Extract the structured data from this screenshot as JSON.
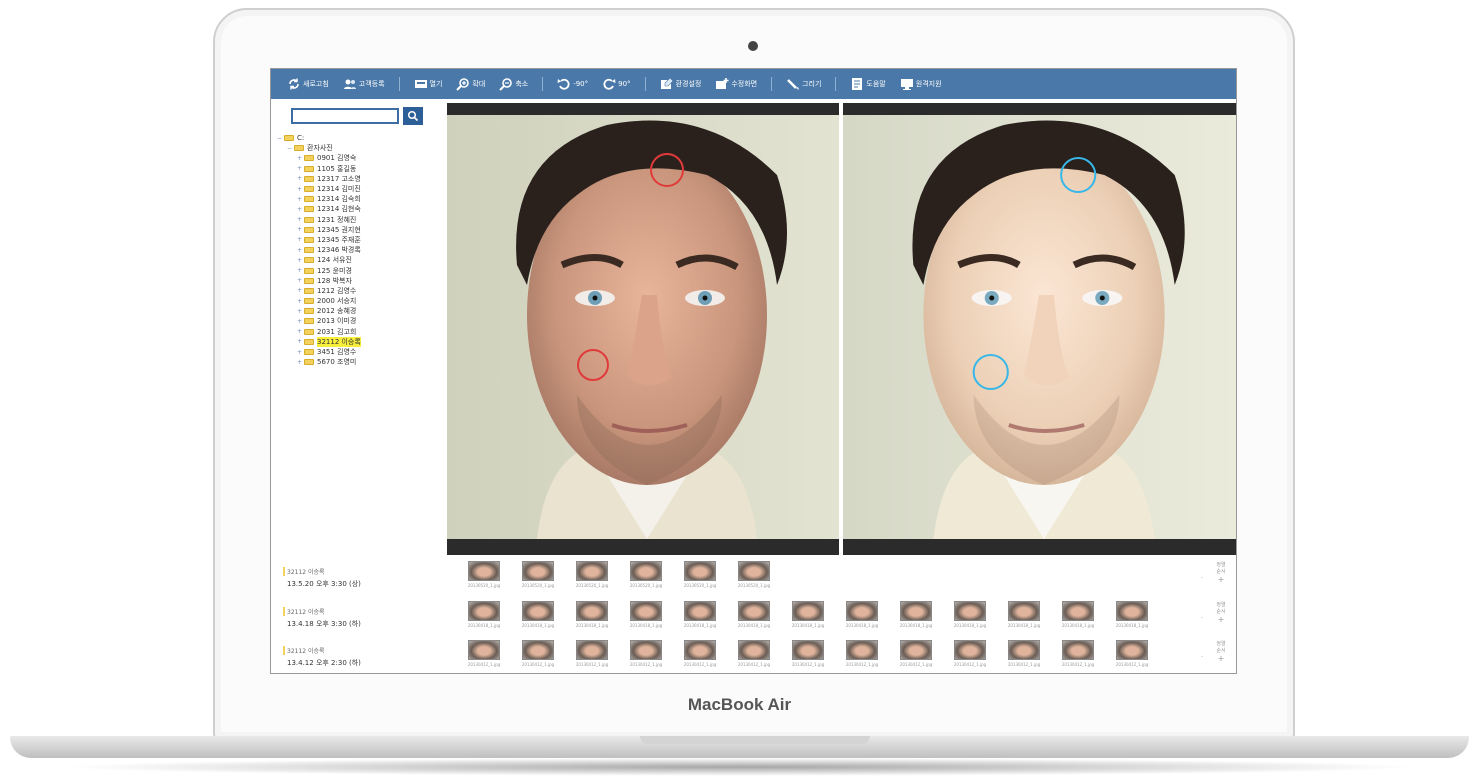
{
  "device": {
    "brand": "MacBook Air"
  },
  "toolbar": {
    "items": [
      {
        "label": "새로고침",
        "icon": "refresh-icon"
      },
      {
        "label": "고객등록",
        "icon": "users-icon"
      },
      {
        "label": "열기",
        "icon": "folder-open-icon"
      },
      {
        "label": "확대",
        "icon": "zoom-in-icon"
      },
      {
        "label": "축소",
        "icon": "zoom-out-icon"
      },
      {
        "label": "-90°",
        "icon": "rotate-left-icon"
      },
      {
        "label": "90°",
        "icon": "rotate-right-icon"
      },
      {
        "label": "환경설정",
        "icon": "settings-icon"
      },
      {
        "label": "수정화면",
        "icon": "edit-icon"
      },
      {
        "label": "그리기",
        "icon": "pen-icon"
      },
      {
        "label": "도움말",
        "icon": "help-icon"
      },
      {
        "label": "원격지원",
        "icon": "monitor-icon"
      }
    ]
  },
  "search": {
    "placeholder": ""
  },
  "tree": {
    "root": "C:",
    "group": "환자사진",
    "items": [
      "0901 김영숙",
      "1105 홍길동",
      "12317 고소영",
      "12314 김미진",
      "12314 김숙희",
      "12314 김현숙",
      "1231 정혜진",
      "12345 권지현",
      "12345 주재훈",
      "12346 박경록",
      "124 서유진",
      "125 윤미경",
      "128 박복자",
      "1212 김영수",
      "2000 서승지",
      "2012 송혜경",
      "2013 이미경",
      "2031 김고희",
      "32112 이승록",
      "3451 김영수",
      "5670 조영미"
    ],
    "selected_index": 18
  },
  "sessions": [
    {
      "patient": "32112 이승록",
      "info": "13.5.20 오후 3:30 (상)",
      "thumb_count": 6,
      "caption": "20130520_1.jpg"
    },
    {
      "patient": "32112 이승록",
      "info": "13.4.18 오후 3:30 (하)",
      "thumb_count": 13,
      "caption": "20130418_1.jpg"
    },
    {
      "patient": "32112 이승록",
      "info": "13.4.12 오후 2:30 (하)",
      "thumb_count": 13,
      "caption": "20130412_1.jpg"
    }
  ],
  "side_control": {
    "label": "정렬\n순서",
    "plus": "+",
    "minus": "-"
  },
  "annotations": {
    "left_color": "#e03a3a",
    "right_color": "#38b8e8"
  }
}
